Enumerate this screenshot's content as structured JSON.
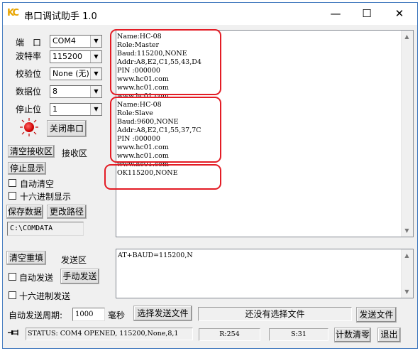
{
  "window": {
    "title": "串口调试助手 1.0",
    "app_icon": "KC",
    "minimize": "—",
    "maximize": "☐",
    "close": "✕"
  },
  "port_settings": {
    "port_label": "端　口",
    "port_value": "COM4",
    "baud_label": "波特率",
    "baud_value": "115200",
    "parity_label": "校验位",
    "parity_value": "None (无)",
    "databits_label": "数据位",
    "databits_value": "8",
    "stopbits_label": "停止位",
    "stopbits_value": "1"
  },
  "controls": {
    "close_port_button": "关闭串口",
    "clear_recv_button": "清空接收区",
    "recv_area_label": "接收区",
    "stop_display_button": "停止显示",
    "auto_clear_label": "自动清空",
    "hex_display_label": "十六进制显示",
    "save_data_button": "保存数据",
    "change_path_button": "更改路径",
    "save_path_value": "C:\\COMDATA",
    "clear_resend_button": "清空重填",
    "send_area_label": "发送区",
    "auto_send_label": "自动发送",
    "manual_send_button": "手动发送",
    "hex_send_label": "十六进制发送",
    "auto_send_period_label": "自动发送周期:",
    "auto_send_period_value": "1000",
    "ms_label": "毫秒",
    "select_file_button": "选择发送文件",
    "file_status_text": "还没有选择文件",
    "send_file_button": "发送文件"
  },
  "receive": {
    "lines": [
      "Name:HC-08",
      "Role:Master",
      "Baud:115200,NONE",
      "Addr:A8,E2,C1,55,43,D4",
      "PIN :000000",
      "www.hc01.com",
      "www.hc01.com",
      "www.hc01.com",
      "Name:HC-08",
      "Role:Slave",
      "Baud:9600,NONE",
      "Addr:A8,E2,C1,55,37,7C",
      "PIN :000000",
      "www.hc01.com",
      "www.hc01.com",
      "www.hc01.com",
      "OK115200,NONE"
    ]
  },
  "send": {
    "text": "AT+BAUD=115200,N"
  },
  "status_bar": {
    "pin_icon": "pin-icon",
    "status_text": "STATUS: COM4 OPENED, 115200,None,8,1",
    "r_count": "R:254",
    "s_count": "S:31",
    "clear_count_button": "计数清零",
    "exit_button": "退出"
  },
  "colors": {
    "highlight": "#e31c25",
    "frame": "#4a7fc1",
    "icon": "#e8a400",
    "indicator": "#d10000"
  }
}
